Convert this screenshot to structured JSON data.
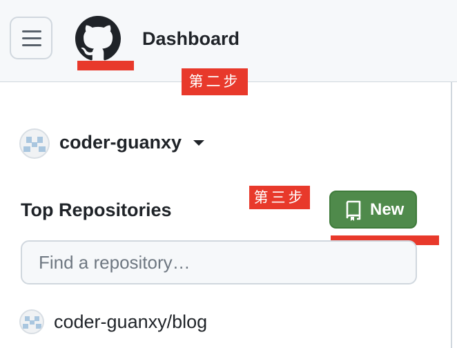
{
  "header": {
    "title": "Dashboard",
    "menu_icon": "hamburger-icon",
    "logo_icon": "github-octocat-icon"
  },
  "annotations": {
    "step2": "第二步",
    "step3": "第三步",
    "color": "#e8392b"
  },
  "sidebar": {
    "user": {
      "name": "coder-guanxy",
      "avatar_icon": "identicon-avatar"
    },
    "top_repositories": {
      "title": "Top Repositories",
      "new_button": {
        "label": "New",
        "icon": "repo-icon",
        "color": "#4f8a4b"
      },
      "search": {
        "placeholder": "Find a repository…",
        "value": ""
      },
      "repos": [
        {
          "name": "coder-guanxy/blog",
          "avatar_icon": "identicon-avatar"
        }
      ]
    }
  }
}
